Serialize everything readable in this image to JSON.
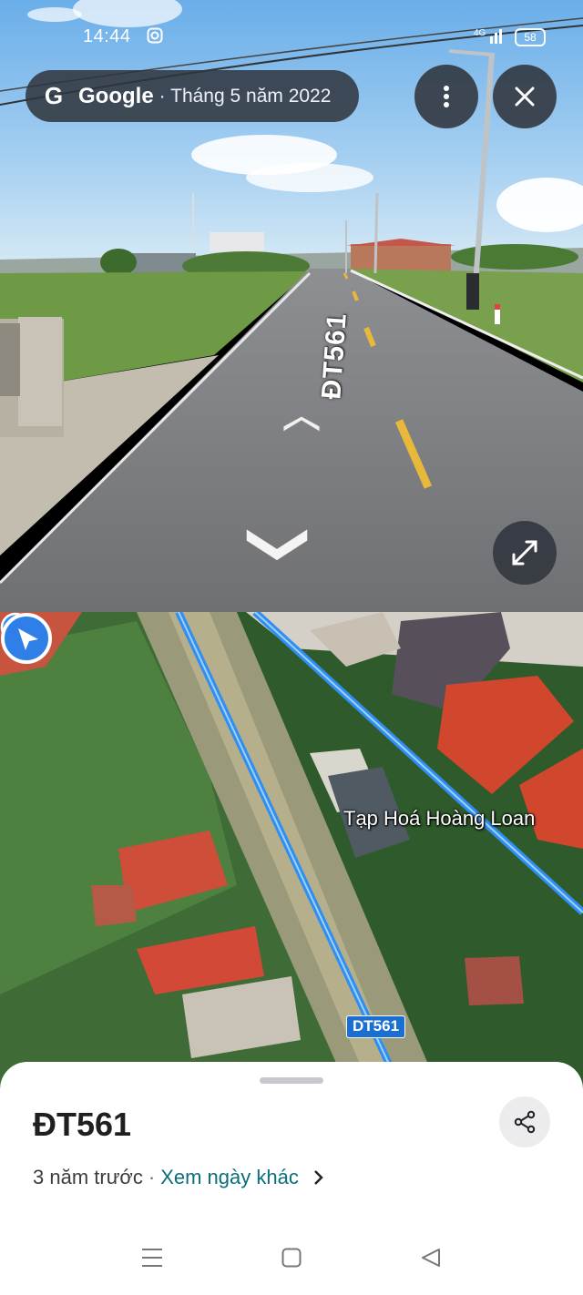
{
  "status_bar": {
    "time": "14:44",
    "network": "4G",
    "battery": "58",
    "icons": [
      "instagram-icon",
      "signal-icon",
      "battery-icon"
    ]
  },
  "source_pill": {
    "logo_letter": "G",
    "provider": "Google",
    "date": "· Tháng 5 năm 2022"
  },
  "street_view": {
    "road_marking": "ĐT561",
    "icons": [
      "more-vert-icon",
      "close-icon",
      "expand-icon",
      "forward-arrow-icon",
      "backward-arrow-icon"
    ]
  },
  "map": {
    "poi_name": "Tạp Hoá Hoàng Loan",
    "road_shield": "DT561",
    "route_color": "#2f8ef0",
    "icons": [
      "location-arrow-icon",
      "shop-pin-icon"
    ]
  },
  "sheet": {
    "title": "ĐT561",
    "age": "3 năm trước",
    "separator": "·",
    "link": "Xem ngày khác",
    "icons": [
      "share-icon",
      "chevron-right-icon"
    ]
  },
  "system_nav": {
    "icons": [
      "menu-icon",
      "home-square-icon",
      "back-triangle-icon"
    ]
  }
}
